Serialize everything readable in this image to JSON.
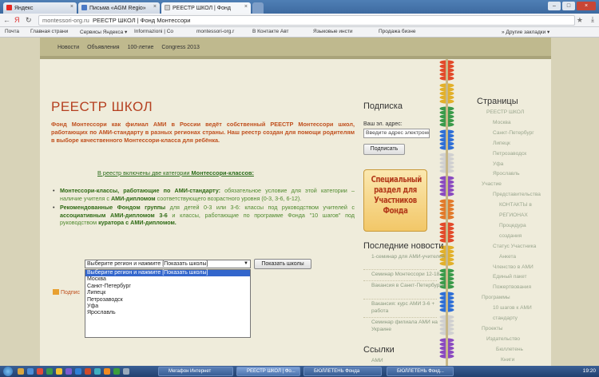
{
  "browser": {
    "tabs": [
      {
        "label": "Яндекс",
        "fav_color": "#e52620"
      },
      {
        "label": "Письма «AGM Regio»",
        "fav_color": "#4a79c5"
      },
      {
        "label": "РЕЕСТР ШКОЛ | Фонд",
        "fav_color": "#cfcfcf",
        "active": true
      }
    ],
    "url_prefix": "montessori-org.ru",
    "url_title": "РЕЕСТР ШКОЛ | Фонд Монтессори",
    "bookmarks": [
      "Почта",
      "Главная страни",
      "Сервисы Яндекса ▾",
      "Informazioni | Co",
      "montessori-org.r",
      "В Контакте Авт",
      "Языковые инсти",
      "Продажа бизне",
      "» Другие закладки ▾"
    ]
  },
  "site_nav": [
    "Новости",
    "Объявления",
    "100-летие",
    "Congress 2013"
  ],
  "main": {
    "title": "РЕЕСТР ШКОЛ",
    "intro": "Фонд Монтессори как филиал АМИ в России ведёт собственный РЕЕСТР Монтессори школ, работающих по АМИ-стандарту в разных регионах страны. Наш реестр создан для помощи родителям в выборе качественного Монтессори-класса для ребёнка.",
    "two_cats_prefix": "В реестр включены две категории ",
    "two_cats_bold": "Монтессори-классов:",
    "bullet1_bold": "Монтессори-классы, работающие по АМИ-стандарту:",
    "bullet1_text": " обязательное условие для этой категории – наличие учителя с ",
    "bullet1_bold2": "АМИ-дипломом",
    "bullet1_text2": " соответствующего возрастного уровня (0-3, 3-6, 6-12).",
    "bullet2_bold": "Рекомендованные Фондом группы",
    "bullet2_text": " для детей 0-3 или 3-6: классы под руководством учителей с ",
    "bullet2_bold2": "ассоциативным АМИ-дипломом 3-6",
    "bullet2_text2": " и классы, работающие по программе Фонда \"10 шагов\" под руководством ",
    "bullet2_bold3": "куратора с АМИ-дипломом.",
    "select_value": "Выберите регион и нажмите [Показать школы]",
    "show_button": "Показать школы",
    "dropdown_options": [
      "Выберите регион и нажмите [Показать школы]",
      "Москва",
      "Санкт-Петербург",
      "Липецк",
      "Петрозаводск",
      "Уфа",
      "Ярославль"
    ],
    "subscribe_link": "Подпис"
  },
  "subscription": {
    "heading": "Подписка",
    "email_label": "Ваш эл. адрес:",
    "email_placeholder": "Введите адрес электронн",
    "subscribe_button": "Подписать"
  },
  "banner": {
    "lines": [
      "Специальный",
      "раздел для",
      "Участников",
      "Фонда"
    ]
  },
  "news": {
    "heading": "Последние новости",
    "items": [
      "1-семинар для АМИ-учителей",
      "Семинар Монтессори 12-18",
      "Вакансия в Санкт-Петербурге",
      "Вакансия: курс АМИ 3-6 + работа",
      "Семинар филиала АМИ на Украине"
    ]
  },
  "links": {
    "heading": "Ссылки",
    "first": "АМИ"
  },
  "pages": {
    "heading": "Страницы",
    "items": [
      "РЕЕСТР ШКОЛ",
      "Москва",
      "Санкт-Петербург",
      "Липецк",
      "Петрозаводск",
      "Уфа",
      "Ярославль",
      "Участие",
      "Представительства",
      "КОНТАКТЫ в",
      "РЕГИОНАХ",
      "Процедура",
      "создания",
      "Статус Участника",
      "Анкета",
      "Членство в АМИ",
      "Единый пакет",
      "Пожертвования",
      "Программы",
      "10 шагов к АМИ",
      "стандарту",
      "Проекты",
      "Издательство",
      "Бюллетень",
      "Книги"
    ]
  },
  "taskbar": {
    "buttons": [
      "Мегафон Интернет",
      "РЕЕСТР ШКОЛ | Фо...",
      "БЮЛЛЕТЕНЬ Фонда",
      "БЮЛЛЕТЕНЬ Фонд..."
    ],
    "clock": "19:20"
  },
  "colors": {
    "accent": "#c0501e",
    "green": "#2e6a14",
    "nav_bg": "#bfb98e",
    "page_bg": "#efecdb"
  }
}
